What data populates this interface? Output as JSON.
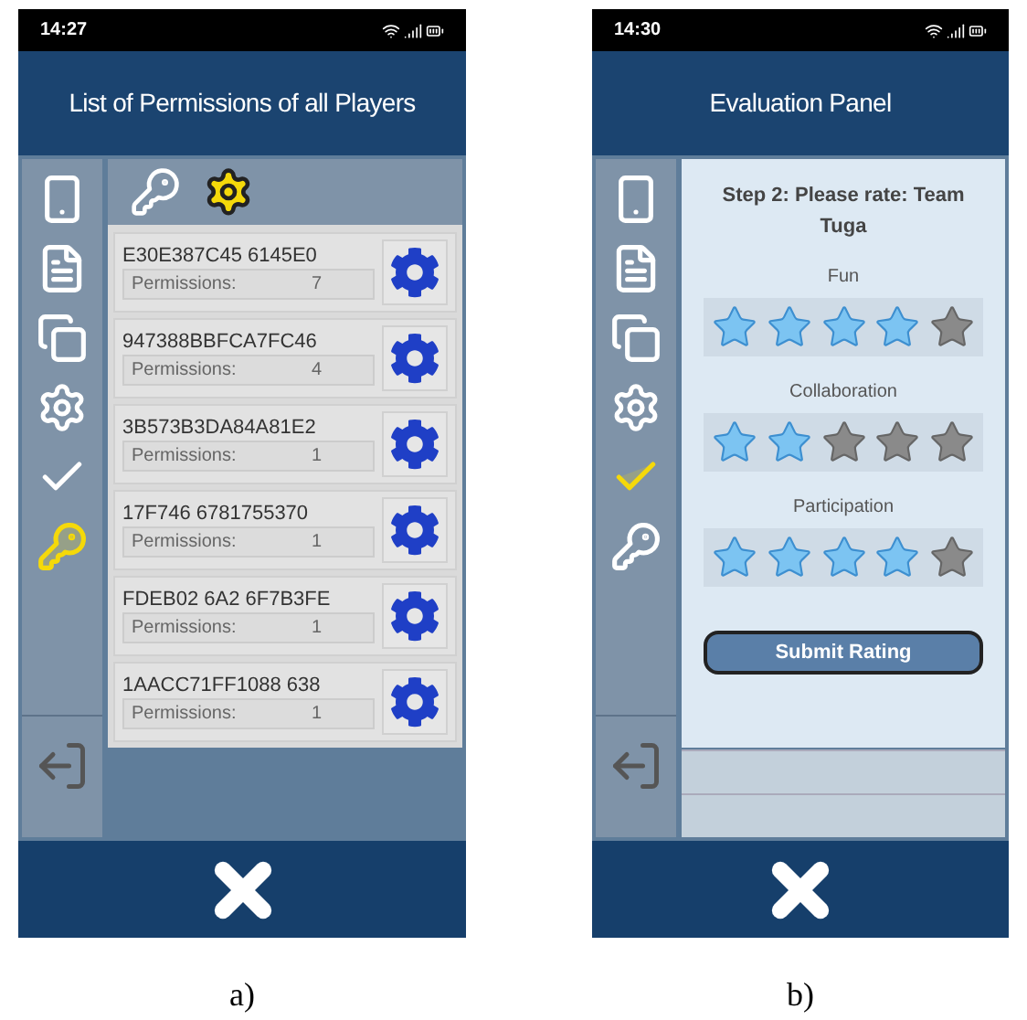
{
  "screens": [
    {
      "kind": "permissions",
      "caption": "a)",
      "time": "14:27",
      "title": "List of Permissions of all Players",
      "sidebar": [
        {
          "kind": "device",
          "selected": false
        },
        {
          "kind": "document",
          "selected": false
        },
        {
          "kind": "cards",
          "selected": false
        },
        {
          "kind": "gear",
          "selected": false
        },
        {
          "kind": "check",
          "selected": false
        },
        {
          "kind": "key",
          "selected": true
        }
      ],
      "toolbar": [
        {
          "kind": "key"
        },
        {
          "kind": "gear"
        }
      ],
      "players": [
        {
          "id": "E30E387C45 6145E0",
          "label": "Permissions:",
          "count": "7"
        },
        {
          "id": "947388BBFCA7FC46",
          "label": "Permissions:",
          "count": "4"
        },
        {
          "id": "3B573B3DA84A81E2",
          "label": "Permissions:",
          "count": "1"
        },
        {
          "id": "17F746 6781755370",
          "label": "Permissions:",
          "count": "1"
        },
        {
          "id": "FDEB02 6A2 6F7B3FE",
          "label": "Permissions:",
          "count": "1"
        },
        {
          "id": "1AACC71FF1088 638",
          "label": "Permissions:",
          "count": "1"
        }
      ]
    },
    {
      "kind": "evaluation",
      "caption": "b)",
      "time": "14:30",
      "title": "Evaluation Panel",
      "sidebar": [
        {
          "kind": "device",
          "selected": false
        },
        {
          "kind": "document",
          "selected": false
        },
        {
          "kind": "cards",
          "selected": false
        },
        {
          "kind": "gear",
          "selected": false
        },
        {
          "kind": "check",
          "selected": true
        },
        {
          "kind": "key",
          "selected": false
        }
      ],
      "heading": "Step 2: Please rate: Team Tuga",
      "ratings": [
        {
          "label": "Fun",
          "stars": 4
        },
        {
          "label": "Collaboration",
          "stars": 2
        },
        {
          "label": "Participation",
          "stars": 4
        }
      ],
      "submit": "Submit Rating"
    }
  ]
}
